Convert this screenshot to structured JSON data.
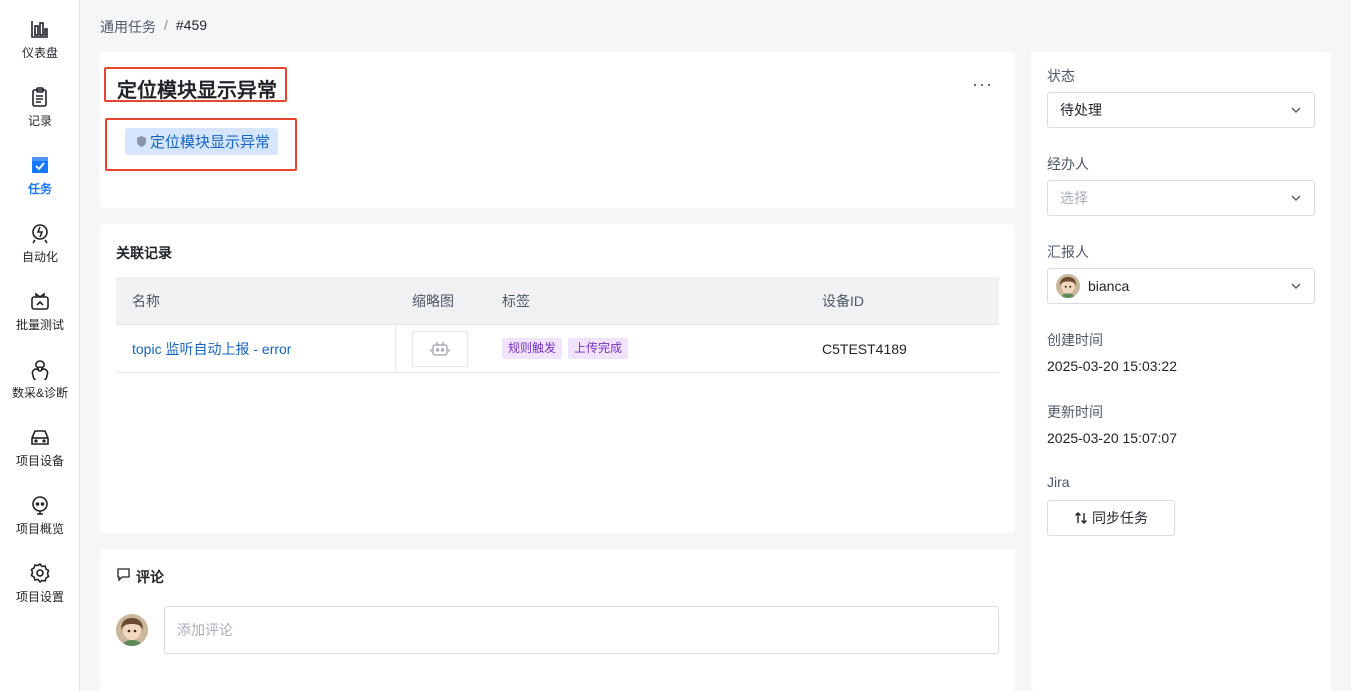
{
  "sidebar": {
    "items": [
      {
        "label": "仪表盘",
        "icon": "dashboard-icon"
      },
      {
        "label": "记录",
        "icon": "records-icon"
      },
      {
        "label": "任务",
        "icon": "task-icon",
        "active": true
      },
      {
        "label": "自动化",
        "icon": "automation-icon"
      },
      {
        "label": "批量测试",
        "icon": "batch-test-icon"
      },
      {
        "label": "数采&诊断",
        "icon": "diagnosis-icon"
      },
      {
        "label": "项目设备",
        "icon": "device-icon"
      },
      {
        "label": "项目概览",
        "icon": "overview-icon"
      },
      {
        "label": "项目设置",
        "icon": "settings-icon"
      }
    ]
  },
  "breadcrumb": {
    "parent": "通用任务",
    "separator": "/",
    "current": "#459"
  },
  "task": {
    "title": "定位模块显示异常",
    "more": "···",
    "tag_label": "定位模块显示异常"
  },
  "related": {
    "title": "关联记录",
    "columns": [
      "名称",
      "缩略图",
      "标签",
      "设备ID"
    ],
    "rows": [
      {
        "name": "topic 监听自动上报 - error",
        "labels": [
          "规则触发",
          "上传完成"
        ],
        "device_id": "C5TEST4189"
      }
    ]
  },
  "comments": {
    "title": "评论",
    "placeholder": "添加评论"
  },
  "details": {
    "status_label": "状态",
    "status_value": "待处理",
    "assignee_label": "经办人",
    "assignee_placeholder": "选择",
    "reporter_label": "汇报人",
    "reporter_value": "bianca",
    "created_label": "创建时间",
    "created_value": "2025-03-20 15:03:22",
    "updated_label": "更新时间",
    "updated_value": "2025-03-20 15:07:07",
    "jira_label": "Jira",
    "sync_button": "同步任务"
  },
  "colors": {
    "accent": "#1677ff",
    "link": "#1764c0",
    "highlight": "#e8452f",
    "tag_bg": "#f0e3fb",
    "tag_text": "#7a34c5"
  }
}
